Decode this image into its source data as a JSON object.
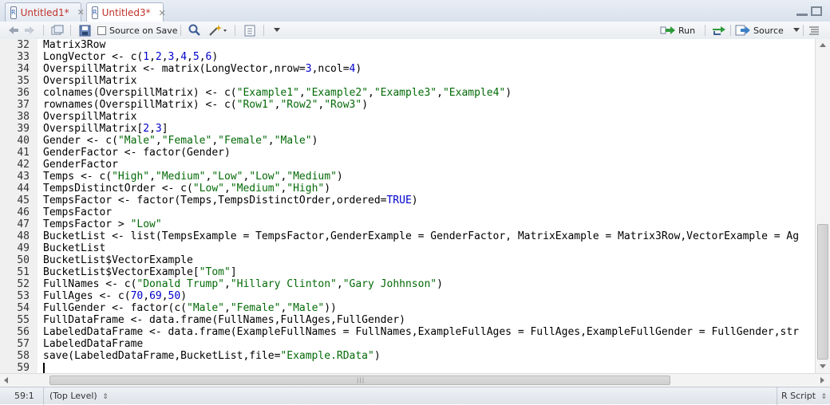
{
  "tabs": [
    {
      "label": "Untitled1*",
      "active": false
    },
    {
      "label": "Untitled3*",
      "active": true
    }
  ],
  "toolbar": {
    "source_on_save": "Source on Save",
    "run": "Run",
    "source": "Source"
  },
  "editor": {
    "lines": [
      {
        "n": "32",
        "parts": [
          [
            "Matrix3Row",
            ""
          ]
        ]
      },
      {
        "n": "33",
        "parts": [
          [
            "LongVector <- c(",
            ""
          ],
          [
            "1",
            "num"
          ],
          [
            ",",
            ""
          ],
          [
            "2",
            "num"
          ],
          [
            ",",
            ""
          ],
          [
            "3",
            "num"
          ],
          [
            ",",
            ""
          ],
          [
            "4",
            "num"
          ],
          [
            ",",
            ""
          ],
          [
            "5",
            "num"
          ],
          [
            ",",
            ""
          ],
          [
            "6",
            "num"
          ],
          [
            ")",
            ""
          ]
        ]
      },
      {
        "n": "34",
        "parts": [
          [
            "OverspillMatrix <- matrix(LongVector,nrow=",
            ""
          ],
          [
            "3",
            "num"
          ],
          [
            ",ncol=",
            ""
          ],
          [
            "4",
            "num"
          ],
          [
            ")",
            ""
          ]
        ]
      },
      {
        "n": "35",
        "parts": [
          [
            "OverspillMatrix",
            ""
          ]
        ]
      },
      {
        "n": "36",
        "parts": [
          [
            "colnames(OverspillMatrix) <- c(",
            ""
          ],
          [
            "\"Example1\"",
            "str"
          ],
          [
            ",",
            ""
          ],
          [
            "\"Example2\"",
            "str"
          ],
          [
            ",",
            ""
          ],
          [
            "\"Example3\"",
            "str"
          ],
          [
            ",",
            ""
          ],
          [
            "\"Example4\"",
            "str"
          ],
          [
            ")",
            ""
          ]
        ]
      },
      {
        "n": "37",
        "parts": [
          [
            "rownames(OverspillMatrix) <- c(",
            ""
          ],
          [
            "\"Row1\"",
            "str"
          ],
          [
            ",",
            ""
          ],
          [
            "\"Row2\"",
            "str"
          ],
          [
            ",",
            ""
          ],
          [
            "\"Row3\"",
            "str"
          ],
          [
            ")",
            ""
          ]
        ]
      },
      {
        "n": "38",
        "parts": [
          [
            "OverspillMatrix",
            ""
          ]
        ]
      },
      {
        "n": "39",
        "parts": [
          [
            "OverspillMatrix[",
            ""
          ],
          [
            "2",
            "num"
          ],
          [
            ",",
            ""
          ],
          [
            "3",
            "num"
          ],
          [
            "]",
            ""
          ]
        ]
      },
      {
        "n": "40",
        "parts": [
          [
            "Gender <- c(",
            ""
          ],
          [
            "\"Male\"",
            "str"
          ],
          [
            ",",
            ""
          ],
          [
            "\"Female\"",
            "str"
          ],
          [
            ",",
            ""
          ],
          [
            "\"Female\"",
            "str"
          ],
          [
            ",",
            ""
          ],
          [
            "\"Male\"",
            "str"
          ],
          [
            ")",
            ""
          ]
        ]
      },
      {
        "n": "41",
        "parts": [
          [
            "GenderFactor <- factor(Gender)",
            ""
          ]
        ]
      },
      {
        "n": "42",
        "parts": [
          [
            "GenderFactor",
            ""
          ]
        ]
      },
      {
        "n": "43",
        "parts": [
          [
            "Temps <- c(",
            ""
          ],
          [
            "\"High\"",
            "str"
          ],
          [
            ",",
            ""
          ],
          [
            "\"Medium\"",
            "str"
          ],
          [
            ",",
            ""
          ],
          [
            "\"Low\"",
            "str"
          ],
          [
            ",",
            ""
          ],
          [
            "\"Low\"",
            "str"
          ],
          [
            ",",
            ""
          ],
          [
            "\"Medium\"",
            "str"
          ],
          [
            ")",
            ""
          ]
        ]
      },
      {
        "n": "44",
        "parts": [
          [
            "TempsDistinctOrder <- c(",
            ""
          ],
          [
            "\"Low\"",
            "str"
          ],
          [
            ",",
            ""
          ],
          [
            "\"Medium\"",
            "str"
          ],
          [
            ",",
            ""
          ],
          [
            "\"High\"",
            "str"
          ],
          [
            ")",
            ""
          ]
        ]
      },
      {
        "n": "45",
        "parts": [
          [
            "TempsFactor <- factor(Temps,TempsDistinctOrder,ordered=",
            ""
          ],
          [
            "TRUE",
            "kw"
          ],
          [
            ")",
            ""
          ]
        ]
      },
      {
        "n": "46",
        "parts": [
          [
            "TempsFactor",
            ""
          ]
        ]
      },
      {
        "n": "47",
        "parts": [
          [
            "TempsFactor > ",
            ""
          ],
          [
            "\"Low\"",
            "str"
          ]
        ]
      },
      {
        "n": "48",
        "parts": [
          [
            "BucketList <- list(TempsExample = TempsFactor,GenderExample = GenderFactor, MatrixExample = Matrix3Row,VectorExample = Ag",
            ""
          ]
        ]
      },
      {
        "n": "49",
        "parts": [
          [
            "BucketList",
            ""
          ]
        ]
      },
      {
        "n": "50",
        "parts": [
          [
            "BucketList$VectorExample",
            ""
          ]
        ]
      },
      {
        "n": "51",
        "parts": [
          [
            "BucketList$VectorExample[",
            ""
          ],
          [
            "\"Tom\"",
            "str"
          ],
          [
            "]",
            ""
          ]
        ]
      },
      {
        "n": "52",
        "parts": [
          [
            "FullNames <- c(",
            ""
          ],
          [
            "\"Donald Trump\"",
            "str"
          ],
          [
            ",",
            ""
          ],
          [
            "\"Hillary Clinton\"",
            "str"
          ],
          [
            ",",
            ""
          ],
          [
            "\"Gary Johhnson\"",
            "str"
          ],
          [
            ")",
            ""
          ]
        ]
      },
      {
        "n": "53",
        "parts": [
          [
            "FullAges <- c(",
            ""
          ],
          [
            "70",
            "num"
          ],
          [
            ",",
            ""
          ],
          [
            "69",
            "num"
          ],
          [
            ",",
            ""
          ],
          [
            "50",
            "num"
          ],
          [
            ")",
            ""
          ]
        ]
      },
      {
        "n": "54",
        "parts": [
          [
            "FullGender <- factor(c(",
            ""
          ],
          [
            "\"Male\"",
            "str"
          ],
          [
            ",",
            ""
          ],
          [
            "\"Female\"",
            "str"
          ],
          [
            ",",
            ""
          ],
          [
            "\"Male\"",
            "str"
          ],
          [
            "))",
            ""
          ]
        ]
      },
      {
        "n": "55",
        "parts": [
          [
            "FullDataFrame <- data.frame(FullNames,FullAges,FullGender)",
            ""
          ]
        ]
      },
      {
        "n": "56",
        "parts": [
          [
            "LabeledDataFrame <- data.frame(ExampleFullNames = FullNames,ExampleFullAges = FullAges,ExampleFullGender = FullGender,str",
            ""
          ]
        ]
      },
      {
        "n": "57",
        "parts": [
          [
            "LabeledDataFrame",
            ""
          ]
        ]
      },
      {
        "n": "58",
        "parts": [
          [
            "save(LabeledDataFrame,BucketList,file=",
            ""
          ],
          [
            "\"Example.RData\"",
            "str"
          ],
          [
            ")",
            ""
          ]
        ]
      },
      {
        "n": "59",
        "parts": []
      }
    ]
  },
  "statusbar": {
    "position": "59:1",
    "scope": "(Top Level)",
    "filetype": "R Script"
  },
  "colors": {
    "tab_modified": "#c0322b",
    "string": "#036a07",
    "number": "#0000cd"
  }
}
